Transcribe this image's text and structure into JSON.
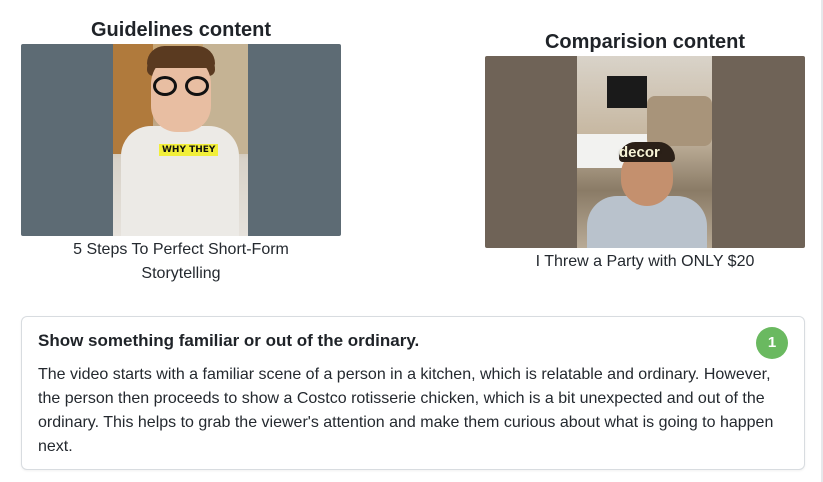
{
  "guidelines": {
    "heading": "Guidelines content",
    "caption": "5 Steps To Perfect Short-Form Storytelling",
    "overlay_text": "WHY THEY"
  },
  "comparison": {
    "heading": "Comparision content",
    "caption": "I Threw a Party with ONLY $20",
    "overlay_text": "decor"
  },
  "insight": {
    "title": "Show something familiar or out of the ordinary.",
    "badge": "1",
    "body": "The video starts with a familiar scene of a person in a kitchen, which is relatable and ordinary. However, the person then proceeds to show a Costco rotisserie chicken, which is a bit unexpected and out of the ordinary. This helps to grab the viewer's attention and make them curious about what is going to happen next.",
    "badge_color": "#6ab960"
  }
}
